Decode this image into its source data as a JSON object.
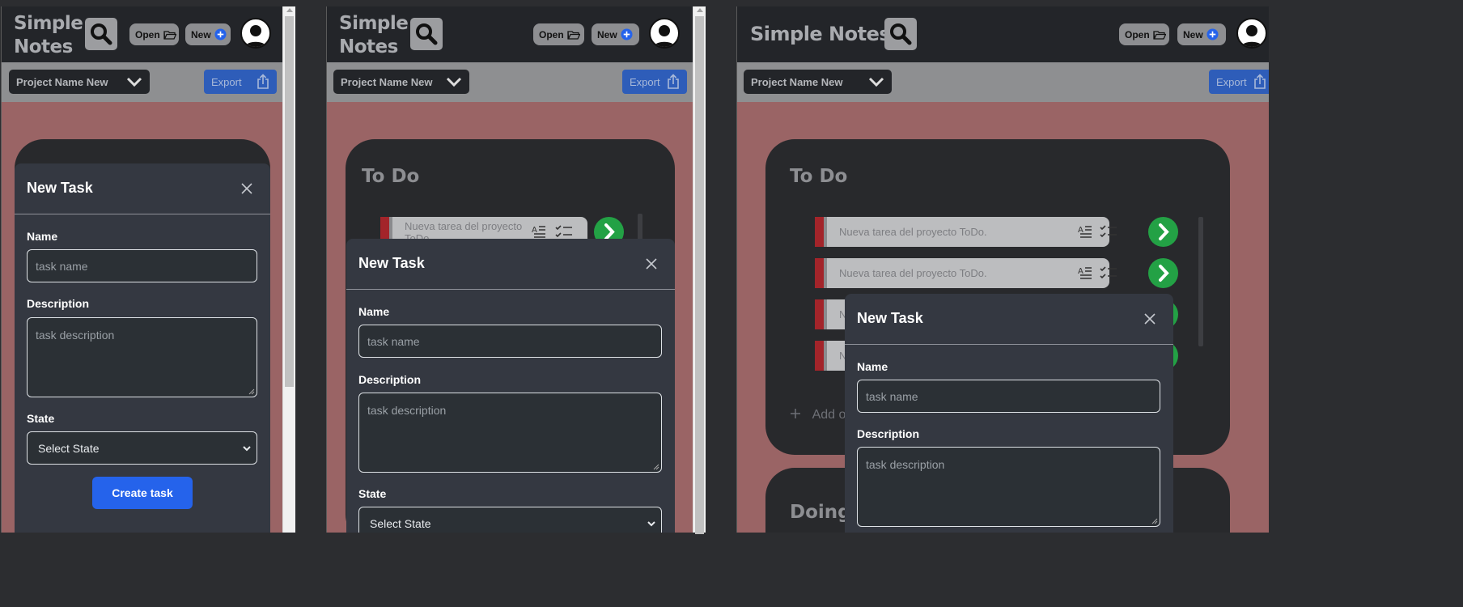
{
  "app": {
    "brand_line1": "Simple",
    "brand_line2": "Notes",
    "brand_full": "Simple Notes",
    "open_label": "Open",
    "new_label": "New",
    "project_name": "Project Name New",
    "export_label": "Export"
  },
  "board": {
    "column_todo": "To Do",
    "column_doing": "Doing",
    "add_label": "Add o",
    "task_text": "Nueva tarea del proyecto ToDo.",
    "task_text_wrap1": "Nueva tarea del proyecto",
    "task_text_wrap2": "ToDo.",
    "task_trunc": "N"
  },
  "modal": {
    "title": "New Task",
    "name_label": "Name",
    "name_placeholder": "task name",
    "description_label": "Description",
    "description_placeholder": "task description",
    "state_label": "State",
    "state_value": "Select State",
    "create_label": "Create task"
  },
  "icons": [
    "search-icon",
    "folder-open-icon",
    "plus-circle-icon",
    "user-avatar-icon",
    "chevron-down-icon",
    "share-icon",
    "text-align-icon",
    "checklist-icon",
    "chevron-right-icon",
    "close-icon",
    "plus-icon"
  ],
  "colors": {
    "bg": "#2c2d30",
    "topbar": "#232529",
    "panel": "#9a6465",
    "accent": "#2563eb",
    "go": "#23a145",
    "task_marker": "#a3242a"
  }
}
